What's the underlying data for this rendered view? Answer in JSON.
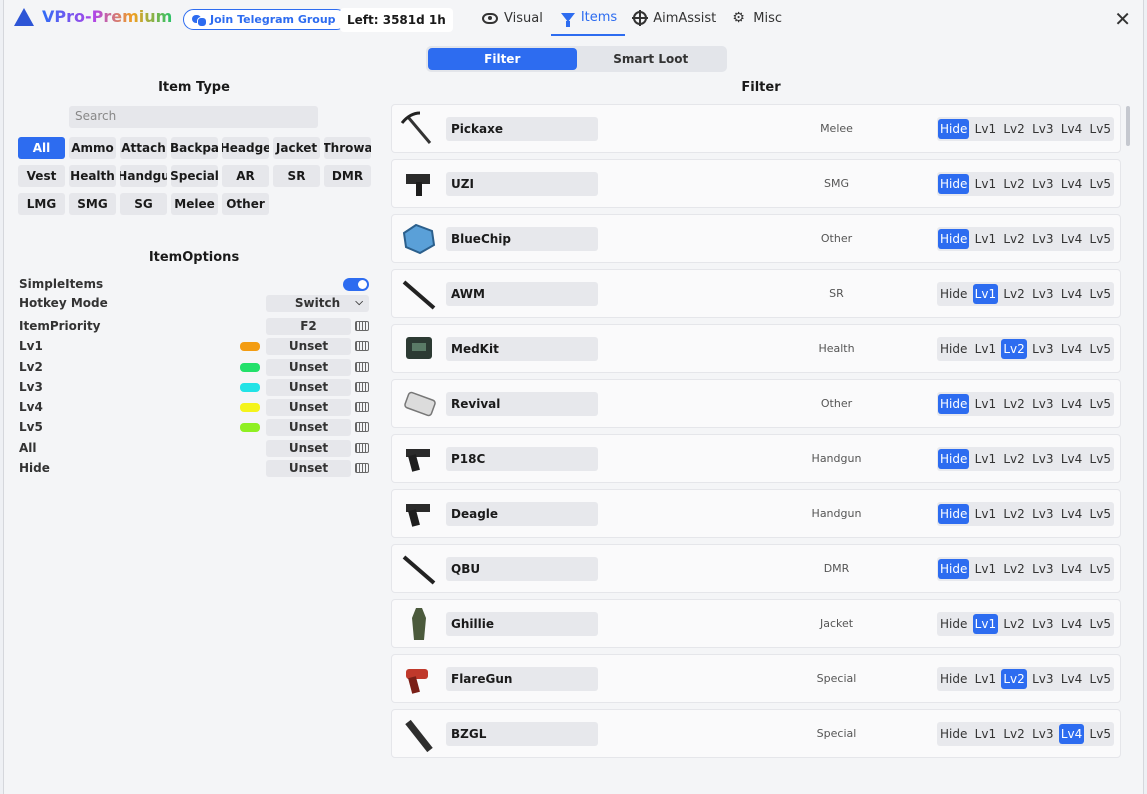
{
  "app": {
    "title": "VPro-Premium"
  },
  "header": {
    "telegram_label": "Join Telegram Group",
    "time_left": "Left: 3581d 1h",
    "tabs": [
      {
        "label": "Visual",
        "icon": "eye-icon"
      },
      {
        "label": "Items",
        "icon": "filter-icon",
        "active": true
      },
      {
        "label": "AimAssist",
        "icon": "crosshair-icon"
      },
      {
        "label": "Misc",
        "icon": "gears-icon"
      }
    ],
    "close_glyph": "✕"
  },
  "subtabs": [
    {
      "label": "Filter",
      "active": true
    },
    {
      "label": "Smart Loot"
    }
  ],
  "item_type": {
    "title": "Item Type",
    "search_placeholder": "Search",
    "chips": [
      "All",
      "Ammo",
      "Attach",
      "Backpa",
      "Headge",
      "Jacket",
      "Throwa",
      "Vest",
      "Health",
      "Handgu",
      "Special",
      "AR",
      "SR",
      "DMR",
      "LMG",
      "SMG",
      "SG",
      "Melee",
      "Other"
    ],
    "active_chip": "All"
  },
  "item_options": {
    "title": "ItemOptions",
    "simple_items": {
      "label": "SimpleItems",
      "enabled": true
    },
    "hotkey_mode": {
      "label": "Hotkey Mode",
      "value": "Switch"
    },
    "item_priority": {
      "label": "ItemPriority",
      "value": "F2"
    },
    "levels": [
      {
        "label": "Lv1",
        "color": "#f39c12",
        "value": "Unset"
      },
      {
        "label": "Lv2",
        "color": "#22e06a",
        "value": "Unset"
      },
      {
        "label": "Lv3",
        "color": "#22e3e6",
        "value": "Unset"
      },
      {
        "label": "Lv4",
        "color": "#f4f41c",
        "value": "Unset"
      },
      {
        "label": "Lv5",
        "color": "#8fef22",
        "value": "Unset"
      },
      {
        "label": "All",
        "color": "",
        "value": "Unset"
      },
      {
        "label": "Hide",
        "color": "",
        "value": "Unset"
      }
    ]
  },
  "filter": {
    "title": "Filter",
    "level_labels": [
      "Hide",
      "Lv1",
      "Lv2",
      "Lv3",
      "Lv4",
      "Lv5"
    ],
    "items": [
      {
        "name": "Pickaxe",
        "category": "Melee",
        "selected": "Hide",
        "icon": "pickaxe-icon"
      },
      {
        "name": "UZI",
        "category": "SMG",
        "selected": "Hide",
        "icon": "uzi-icon"
      },
      {
        "name": "BlueChip",
        "category": "Other",
        "selected": "Hide",
        "icon": "bluechip-icon"
      },
      {
        "name": "AWM",
        "category": "SR",
        "selected": "Lv1",
        "icon": "rifle-icon"
      },
      {
        "name": "MedKit",
        "category": "Health",
        "selected": "Lv2",
        "icon": "medkit-icon"
      },
      {
        "name": "Revival",
        "category": "Other",
        "selected": "Hide",
        "icon": "revival-icon"
      },
      {
        "name": "P18C",
        "category": "Handgun",
        "selected": "Hide",
        "icon": "pistol-icon"
      },
      {
        "name": "Deagle",
        "category": "Handgun",
        "selected": "Hide",
        "icon": "pistol-icon"
      },
      {
        "name": "QBU",
        "category": "DMR",
        "selected": "Hide",
        "icon": "rifle-icon"
      },
      {
        "name": "Ghillie",
        "category": "Jacket",
        "selected": "Lv1",
        "icon": "ghillie-icon"
      },
      {
        "name": "FlareGun",
        "category": "Special",
        "selected": "Lv2",
        "icon": "flaregun-icon"
      },
      {
        "name": "BZGL",
        "category": "Special",
        "selected": "Lv4",
        "icon": "grenade-launcher-icon"
      }
    ]
  }
}
